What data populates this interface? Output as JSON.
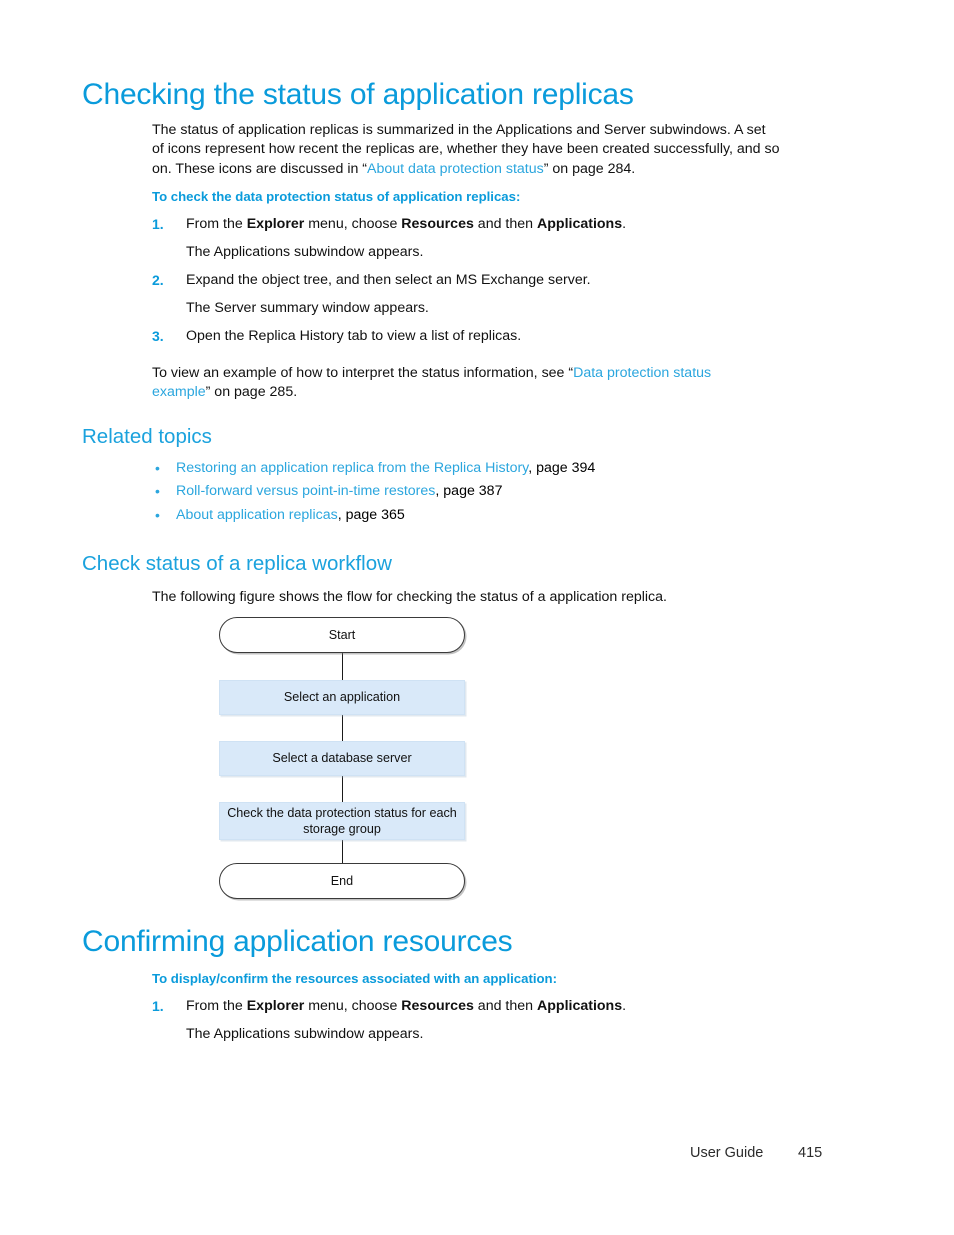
{
  "document": {
    "footer": {
      "label": "User Guide",
      "page_number": "415"
    }
  },
  "colors": {
    "heading_blue": "#0a9bdb",
    "link_blue": "#2ba6de",
    "process_box_fill": "#d9e9f9",
    "terminator_fill": "#ffffff",
    "body_text": "#111111"
  },
  "section_checking": {
    "heading": "Checking the status of application replicas",
    "intro_line1": "The status of application replicas is summarized in the Applications and Server subwindows. A set",
    "intro_line2": "of icons represent how recent the replicas are, whether they have been created successfully, and so",
    "intro_line3_a": "on. These icons are discussed in “",
    "intro_line3_link": "About data protection status",
    "intro_line3_b": "” on page 284.",
    "procedure_title": "To check the data protection status of application replicas:",
    "steps": [
      {
        "number": "1.",
        "text_parts": [
          "From the ",
          "Explorer",
          " menu, choose ",
          "Resources",
          " and then ",
          "Applications",
          "."
        ],
        "result": "The Applications subwindow appears."
      },
      {
        "number": "2.",
        "text": "Expand the object tree, and then select an MS Exchange server.",
        "result": "The Server summary window appears."
      },
      {
        "number": "3.",
        "text": "Open the Replica History tab to view a list of replicas.",
        "result": ""
      }
    ],
    "closing_line1_a": "To view an example of how to interpret the status information, see “",
    "closing_line1_link": "Data protection status",
    "closing_line2_link": "example",
    "closing_line2_b": "” on page 285."
  },
  "related_topics": {
    "heading": "Related topics",
    "items": [
      {
        "link": "Restoring an application replica from the Replica History",
        "page": ", page 394"
      },
      {
        "link": "Roll-forward versus point-in-time restores",
        "page": ", page 387"
      },
      {
        "link": "About application replicas",
        "page": ", page 365"
      }
    ]
  },
  "workflow_section": {
    "heading": "Check status of a replica workflow",
    "intro": "The following figure shows the flow for checking the status of a application replica.",
    "flowchart": {
      "nodes": [
        {
          "id": "start",
          "type": "terminator",
          "label": "Start"
        },
        {
          "id": "select-application",
          "type": "process",
          "label": "Select an application"
        },
        {
          "id": "select-database-server",
          "type": "process",
          "label": "Select a database server"
        },
        {
          "id": "check-status",
          "type": "process",
          "label": "Check the data protection status for each storage group"
        },
        {
          "id": "end",
          "type": "terminator",
          "label": "End"
        }
      ]
    }
  },
  "section_confirming": {
    "heading": "Confirming application resources",
    "procedure_title": "To display/confirm the resources associated with an application:",
    "steps": [
      {
        "number": "1.",
        "text_parts": [
          "From the ",
          "Explorer",
          " menu, choose ",
          "Resources",
          " and then ",
          "Applications",
          "."
        ],
        "result": "The Applications subwindow appears."
      }
    ]
  }
}
